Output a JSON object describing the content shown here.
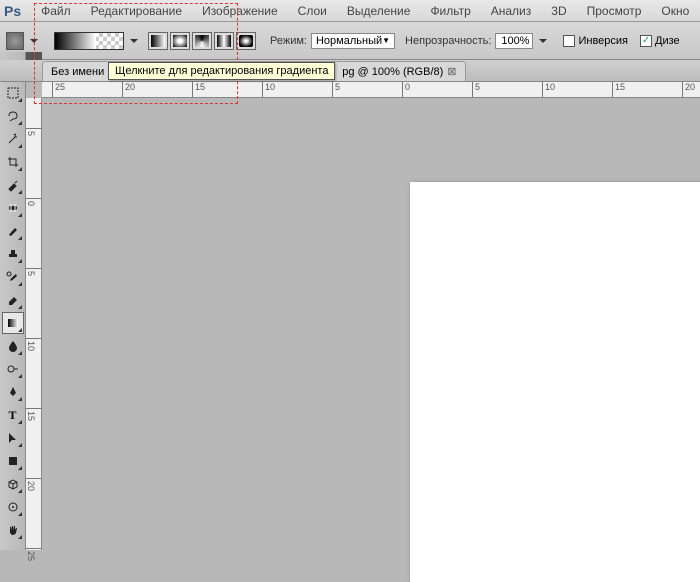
{
  "menu": [
    "Файл",
    "Редактирование",
    "Изображение",
    "Слои",
    "Выделение",
    "Фильтр",
    "Анализ",
    "3D",
    "Просмотр",
    "Окно"
  ],
  "optbar": {
    "mode_label": "Режим:",
    "mode_value": "Нормальный",
    "opacity_label": "Непрозрачность:",
    "opacity_value": "100%",
    "invert_label": "Инверсия",
    "dither_label": "Дизе"
  },
  "tab": {
    "title": "Без имени",
    "suffix": "pg @ 100% (RGB/8)"
  },
  "tooltip": "Щелкните для редактирования градиента",
  "ruler_h": [
    {
      "v": "25",
      "p": 10
    },
    {
      "v": "20",
      "p": 80
    },
    {
      "v": "15",
      "p": 150
    },
    {
      "v": "10",
      "p": 220
    },
    {
      "v": "5",
      "p": 290
    },
    {
      "v": "0",
      "p": 360
    },
    {
      "v": "5",
      "p": 430
    },
    {
      "v": "10",
      "p": 500
    },
    {
      "v": "15",
      "p": 570
    },
    {
      "v": "20",
      "p": 640
    }
  ],
  "ruler_v": [
    {
      "v": "5",
      "p": 30
    },
    {
      "v": "0",
      "p": 100
    },
    {
      "v": "5",
      "p": 170
    },
    {
      "v": "10",
      "p": 240
    },
    {
      "v": "15",
      "p": 310
    },
    {
      "v": "20",
      "p": 380
    },
    {
      "v": "25",
      "p": 450
    }
  ]
}
